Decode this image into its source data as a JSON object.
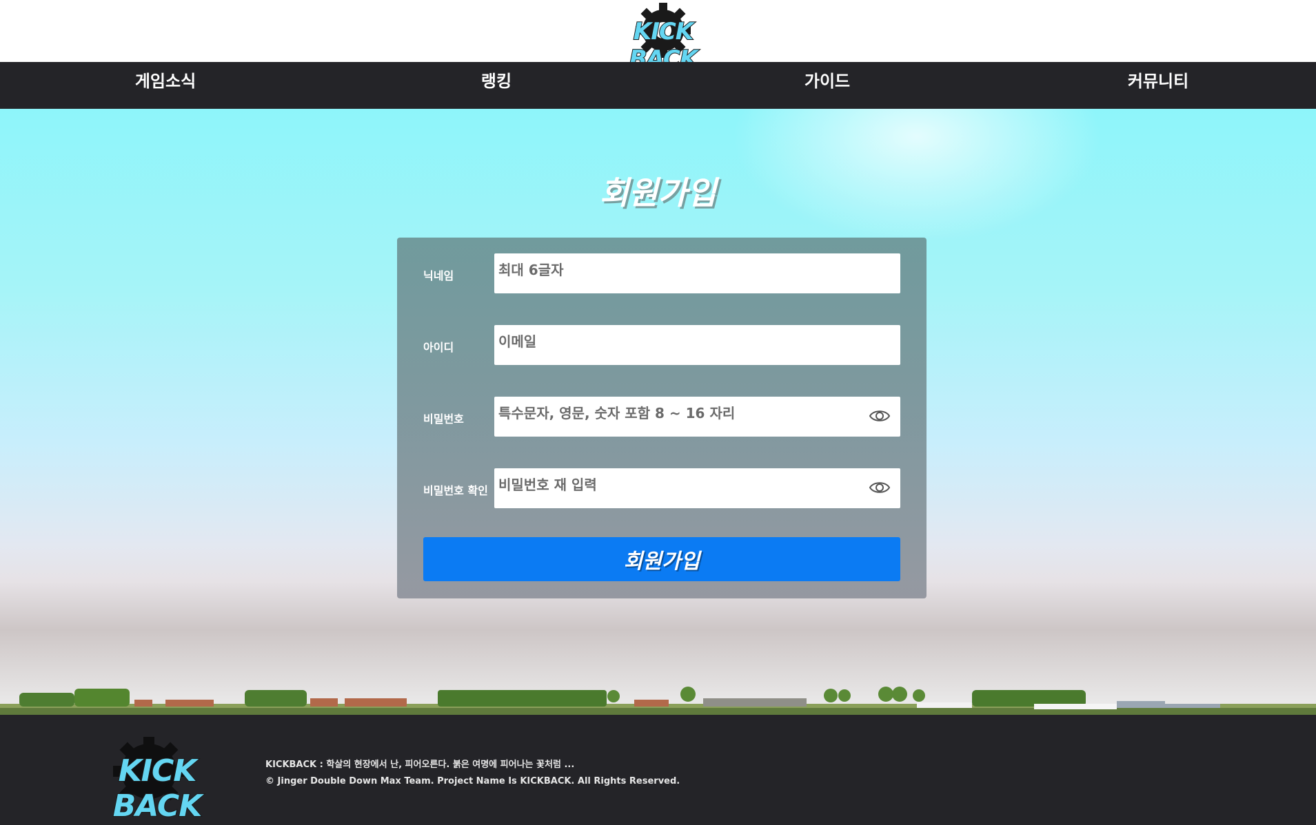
{
  "header": {
    "logo_text": "KICK BACK"
  },
  "nav": {
    "items": [
      {
        "label": "게임소식"
      },
      {
        "label": "랭킹"
      },
      {
        "label": "가이드"
      },
      {
        "label": "커뮤니티"
      }
    ]
  },
  "signup": {
    "title": "회원가입",
    "fields": [
      {
        "label": "닉네임",
        "placeholder": "최대 6글자",
        "value": ""
      },
      {
        "label": "아이디",
        "placeholder": "이메일",
        "value": ""
      },
      {
        "label": "비밀번호",
        "placeholder": "특수문자, 영문, 숫자 포함 8 ~ 16 자리",
        "value": "",
        "icon": "eye-icon"
      },
      {
        "label": "비밀번호 확인",
        "placeholder": "비밀번호 재 입력",
        "value": "",
        "icon": "eye-icon"
      }
    ],
    "submit_label": "회원가입"
  },
  "footer": {
    "logo_text": "KICK BACK",
    "tagline": "KICKBACK : 학살의 현장에서 난, 피어오른다. 붉은 여명에 피어나는 꽃처럼 ...",
    "copyright": "© Jinger Double Down Max Team. Project Name Is KICKBACK. All Rights Reserved."
  },
  "colors": {
    "nav_bg": "#242428",
    "submit_bg": "#0b7bf3",
    "logo_accent": "#64d6f2"
  }
}
